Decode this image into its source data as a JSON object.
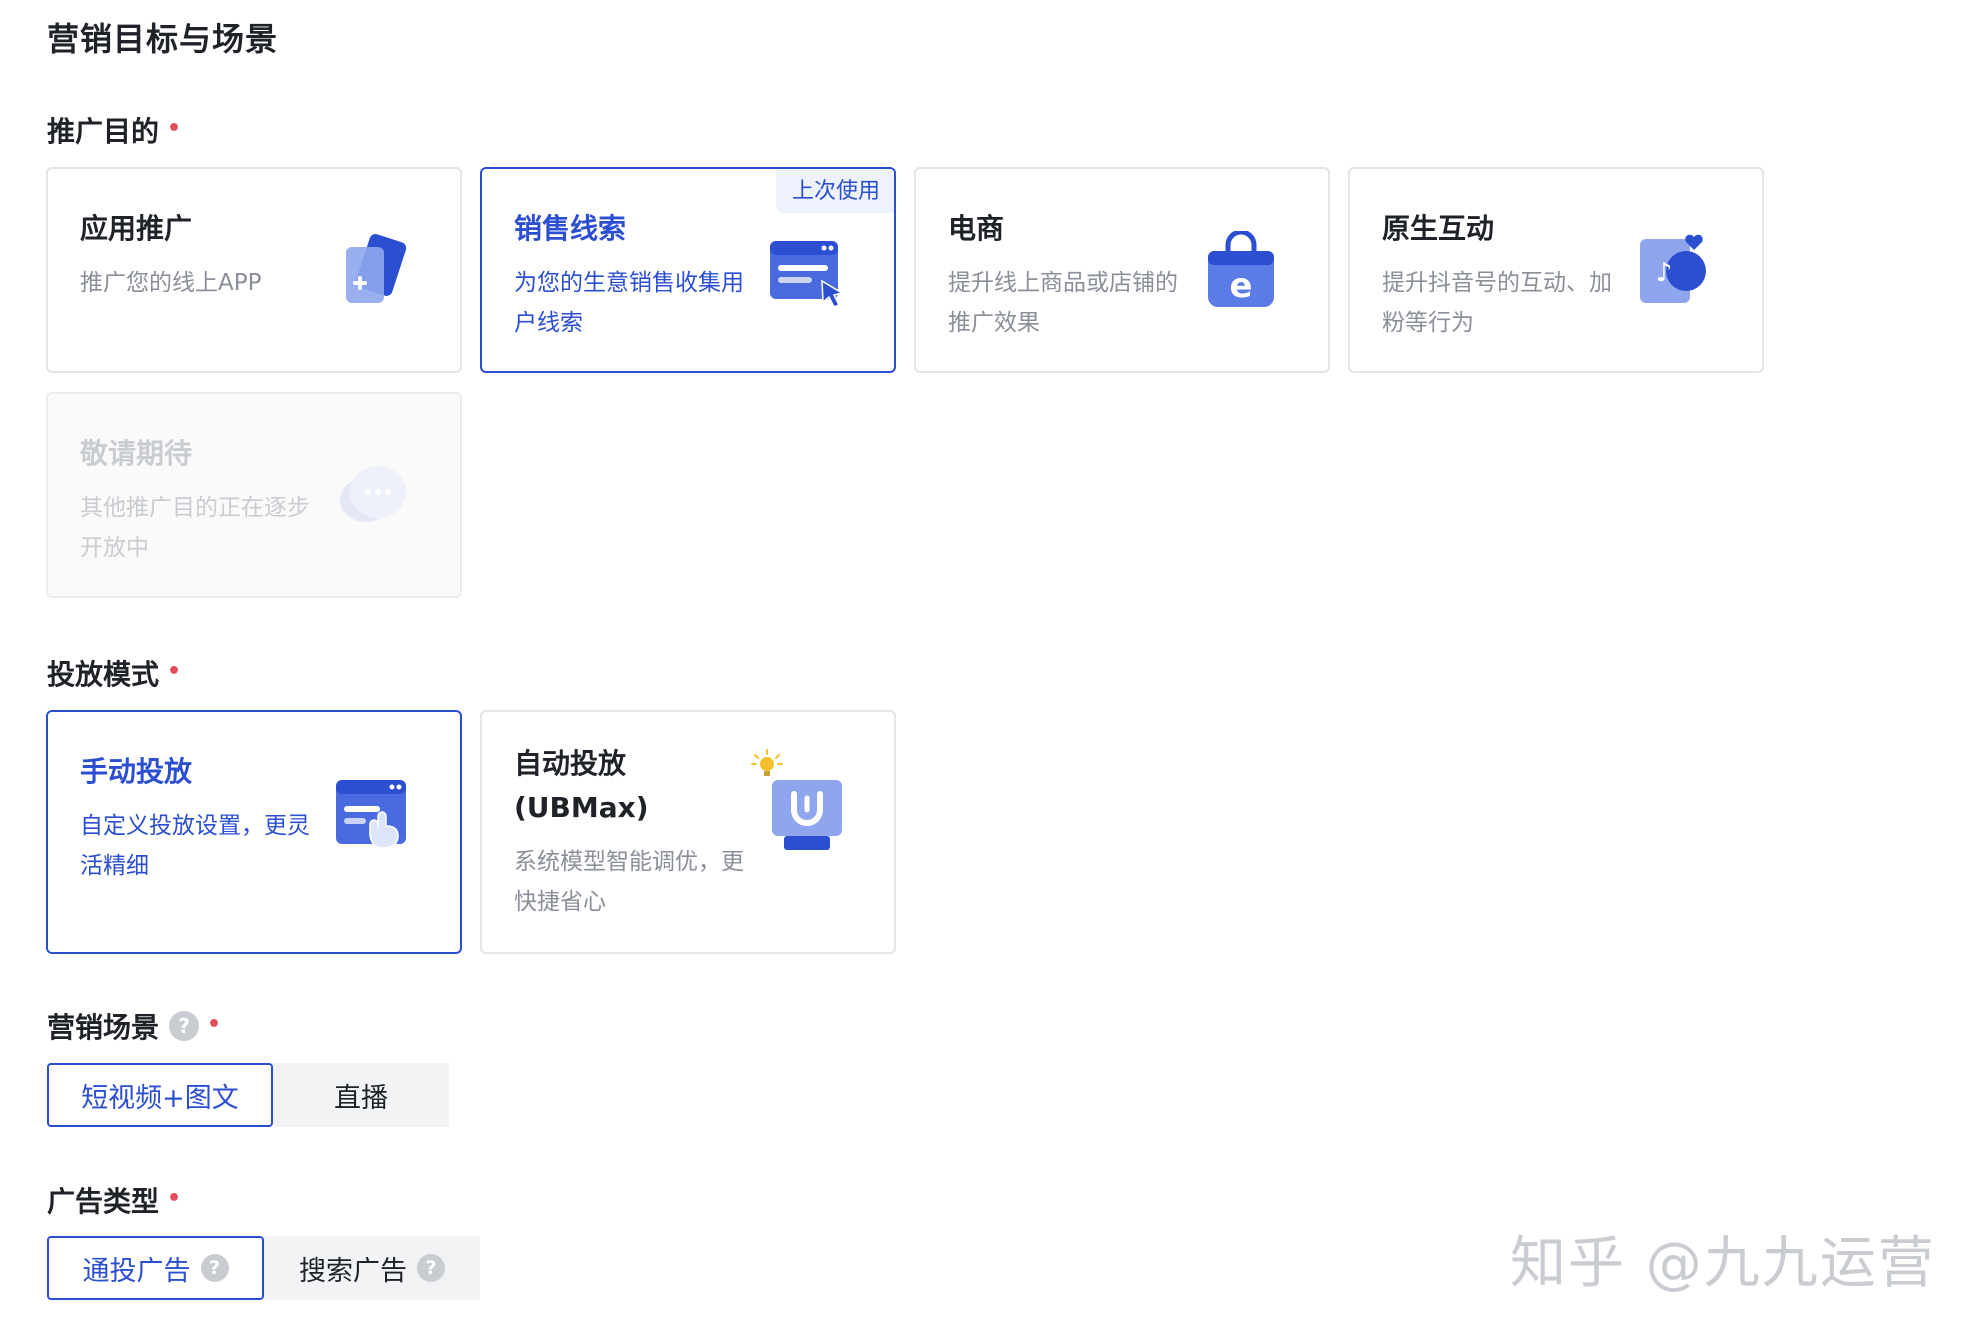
{
  "page_title": "营销目标与场景",
  "purpose": {
    "label": "推广目的",
    "cards": [
      {
        "title": "应用推广",
        "desc": "推广您的线上APP",
        "icon": "app-card-plus-icon"
      },
      {
        "title": "销售线索",
        "desc": "为您的生意销售收集用户线索",
        "badge": "上次使用",
        "icon": "sales-form-cursor-icon"
      },
      {
        "title": "电商",
        "desc": "提升线上商品或店铺的推广效果",
        "icon": "shopping-bag-e-icon"
      },
      {
        "title": "原生互动",
        "desc": "提升抖音号的互动、加粉等行为",
        "icon": "douyin-heart-icon"
      },
      {
        "title": "敬请期待",
        "desc": "其他推广目的正在逐步开放中",
        "icon": "chat-bubble-icon"
      }
    ]
  },
  "mode": {
    "label": "投放模式",
    "cards": [
      {
        "title": "手动投放",
        "desc": "自定义投放设置，更灵活精细",
        "icon": "manual-window-hand-icon"
      },
      {
        "title": "自动投放(UBMax)",
        "desc": "系统模型智能调优，更快捷省心",
        "icon": "auto-monitor-bulb-icon"
      }
    ]
  },
  "scene": {
    "label": "营销场景",
    "help": "?",
    "options": [
      "短视频+图文",
      "直播"
    ]
  },
  "ad_type": {
    "label": "广告类型",
    "options": [
      "通投广告",
      "搜索广告"
    ],
    "help": "?"
  },
  "required_mark": "•",
  "watermark": "知乎 @九九运营",
  "colors": {
    "accent": "#2c4fd1",
    "required": "#e34d59",
    "border": "#e3e5e8",
    "muted_text": "#8a8f99"
  }
}
